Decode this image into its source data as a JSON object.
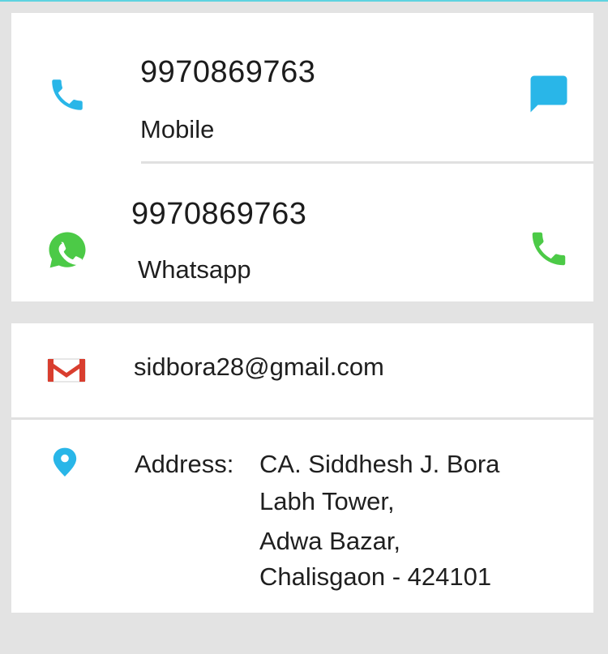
{
  "colors": {
    "mobile_icon": "#29b6e8",
    "sms_icon": "#29b6e8",
    "whatsapp_icon": "#4cca47",
    "call_icon": "#4cca47",
    "gmail_icon": "#d93e2f",
    "location_icon": "#29b6e8",
    "background": "#e3e3e3",
    "card": "#ffffff"
  },
  "contacts": {
    "mobile": {
      "number": "9970869763",
      "label": "Mobile",
      "icon": "phone-icon",
      "action_icon": "message-icon"
    },
    "whatsapp": {
      "number": "9970869763",
      "label": "Whatsapp",
      "icon": "whatsapp-icon",
      "action_icon": "phone-icon"
    }
  },
  "email": {
    "address": "sidbora28@gmail.com",
    "icon": "gmail-icon"
  },
  "address": {
    "label": "Address:",
    "icon": "location-pin-icon",
    "lines": [
      "CA. Siddhesh J. Bora",
      "Labh Tower,",
      "Adwa Bazar,",
      "Chalisgaon - 424101"
    ]
  }
}
